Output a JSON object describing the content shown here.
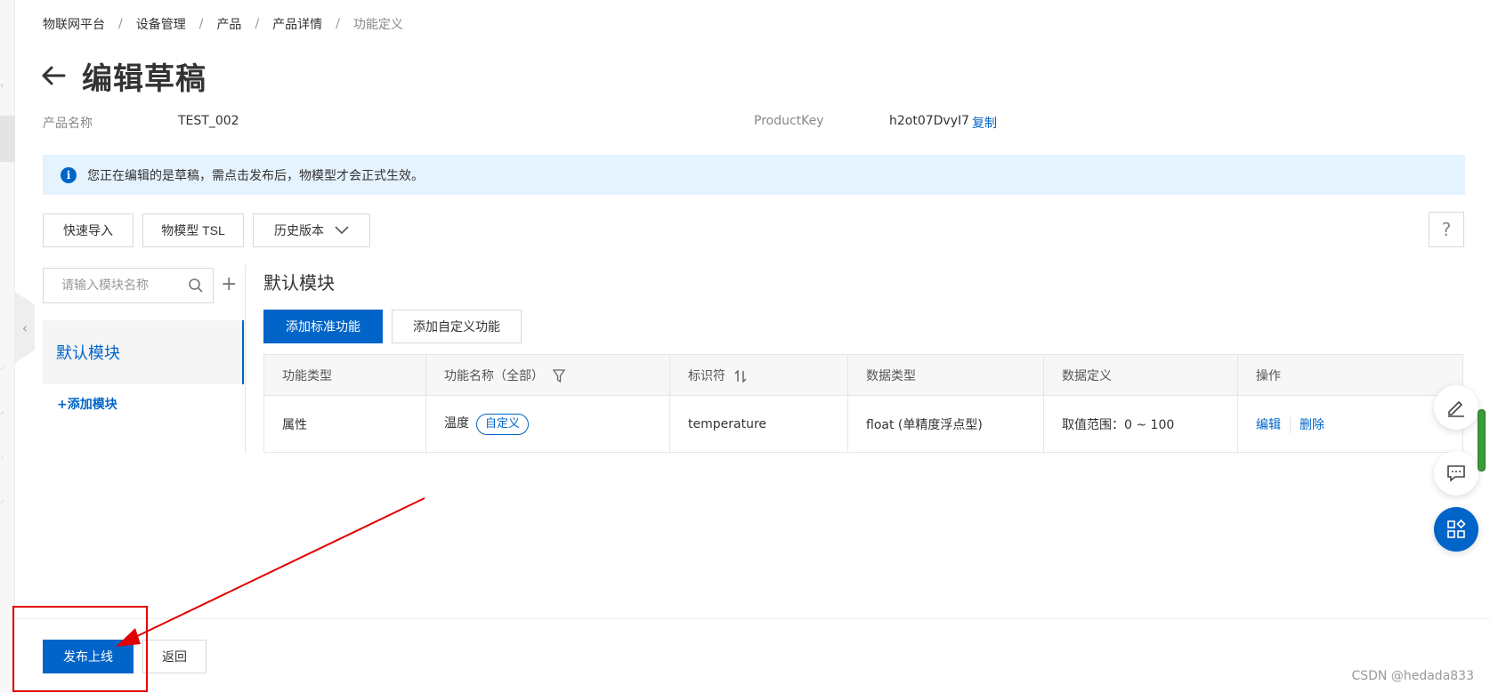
{
  "breadcrumb": [
    "物联网平台",
    "设备管理",
    "产品",
    "产品详情",
    "功能定义"
  ],
  "page": {
    "title": "编辑草稿",
    "product_name_label": "产品名称",
    "product_name_value": "TEST_002",
    "product_key_label": "ProductKey",
    "product_key_value": "h2ot07DvyI7",
    "copy_label": "复制"
  },
  "notice": {
    "text": "您正在编辑的是草稿，需点击发布后，物模型才会正式生效。"
  },
  "toolbar": {
    "quick_import": "快速导入",
    "tsl": "物模型 TSL",
    "history": "历史版本"
  },
  "sidebar": {
    "search_placeholder": "请输入模块名称",
    "modules": [
      {
        "label": "默认模块"
      }
    ],
    "add_module": "+添加模块"
  },
  "main": {
    "module_title": "默认模块",
    "add_standard": "添加标准功能",
    "add_custom": "添加自定义功能",
    "columns": [
      "功能类型",
      "功能名称（全部）",
      "标识符",
      "数据类型",
      "数据定义",
      "操作"
    ],
    "rows": [
      {
        "type": "属性",
        "name": "温度",
        "tag": "自定义",
        "identifier": "temperature",
        "data_type": "float (单精度浮点型)",
        "definition": "取值范围：0 ~ 100",
        "edit": "编辑",
        "delete": "删除"
      }
    ]
  },
  "footer": {
    "publish": "发布上线",
    "back": "返回"
  },
  "help": "?",
  "watermark": "CSDN @hedada833",
  "colors": {
    "primary": "#0064c8",
    "notice_bg": "#e5f3ff",
    "annotation": "#e00000"
  }
}
